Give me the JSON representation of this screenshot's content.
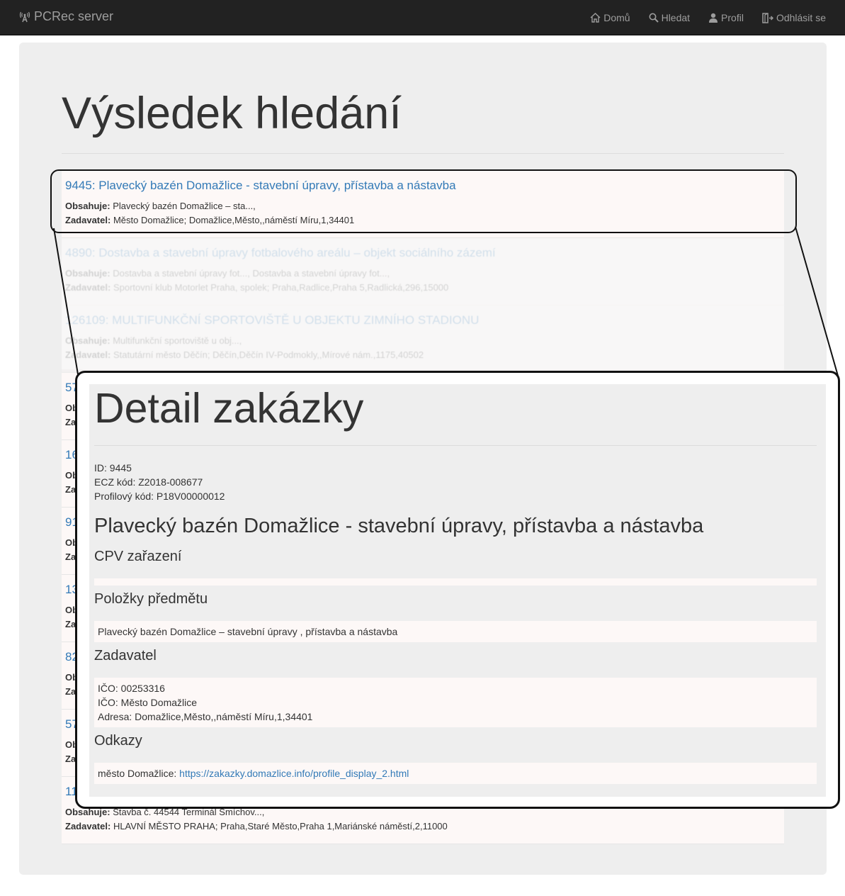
{
  "navbar": {
    "brand": "PCRec server",
    "brand_icon": "signal-tower-icon",
    "items": [
      {
        "label": "Domů",
        "icon": "home-icon"
      },
      {
        "label": "Hledat",
        "icon": "search-icon"
      },
      {
        "label": "Profil",
        "icon": "user-icon"
      },
      {
        "label": "Odhlásit se",
        "icon": "logout-icon"
      }
    ]
  },
  "page": {
    "title": "Výsledek hledání"
  },
  "results": [
    {
      "title": "9445: Plavecký bazén Domažlice - stavební úpravy, přístavba a nástavba",
      "contains_label": "Obsahuje:",
      "contains": "Plavecký bazén Domažlice – sta...,",
      "submitter_label": "Zadavatel:",
      "submitter": "Město Domažlice; Domažlice,Město,,náměstí Míru,1,34401"
    },
    {
      "title": "4890: Dostavba a stavební úpravy fotbalového areálu – objekt sociálního zázemí",
      "contains_label": "Obsahuje:",
      "contains": "Dostavba a stavební úpravy fot..., Dostavba a stavební úpravy fot...,",
      "submitter_label": "Zadavatel:",
      "submitter": "Sportovní klub Motorlet Praha, spolek; Praha,Radlice,Praha 5,Radlická,296,15000"
    },
    {
      "title": "126109: MULTIFUNKČNÍ SPORTOVIŠTĚ U OBJEKTU ZIMNÍHO STADIONU",
      "contains_label": "Obsahuje:",
      "contains": "Multifunkční sportoviště u obj...,",
      "submitter_label": "Zadavatel:",
      "submitter": "Statutární město Děčín; Děčín,Děčín IV-Podmokly,,Mírové nám.,1175,40502"
    },
    {
      "title": "57",
      "contains_label": "Ob",
      "contains": "",
      "submitter_label": "Za",
      "submitter": ""
    },
    {
      "title": "16",
      "contains_label": "Ob",
      "contains": "",
      "submitter_label": "Za",
      "submitter": ""
    },
    {
      "title": "91",
      "contains_label": "Ob",
      "contains": "",
      "submitter_label": "Za",
      "submitter": ""
    },
    {
      "title": "13",
      "contains_label": "Ob",
      "contains": "",
      "submitter_label": "Za",
      "submitter": ""
    },
    {
      "title": "82",
      "contains_label": "Ob",
      "contains": "",
      "submitter_label": "Za",
      "submitter": ""
    },
    {
      "title": "57",
      "contains_label": "Ob",
      "contains": "",
      "submitter_label": "Za",
      "submitter": ""
    },
    {
      "title": "11",
      "contains_label": "Obsahuje:",
      "contains": "Stavba č. 44544 Terminál Smíchov...,",
      "submitter_label": "Zadavatel:",
      "submitter": "HLAVNÍ MĚSTO PRAHA; Praha,Staré Město,Praha 1,Mariánské náměstí,2,11000"
    }
  ],
  "detail": {
    "title": "Detail zakázky",
    "id_line": "ID: 9445",
    "ecz_line": "ECZ kód: Z2018-008677",
    "profile_line": "Profilový kód: P18V00000012",
    "name": "Plavecký bazén Domažlice - stavební úpravy, přístavba a nástavba",
    "cpv_heading": "CPV zařazení",
    "items_heading": "Položky předmětu",
    "item_text": "Plavecký bazén Domažlice – stavební úpravy , přístavba a nástavba",
    "submitter_heading": "Zadavatel",
    "ico_line": "IČO: 00253316",
    "name_line": "IČO: Město Domažlice",
    "address_line": "Adresa: Domažlice,Město,,náměstí Míru,1,34401",
    "links_heading": "Odkazy",
    "link_prefix": "město Domažlice: ",
    "link_url": "https://zakazky.domazlice.info/profile_display_2.html"
  }
}
